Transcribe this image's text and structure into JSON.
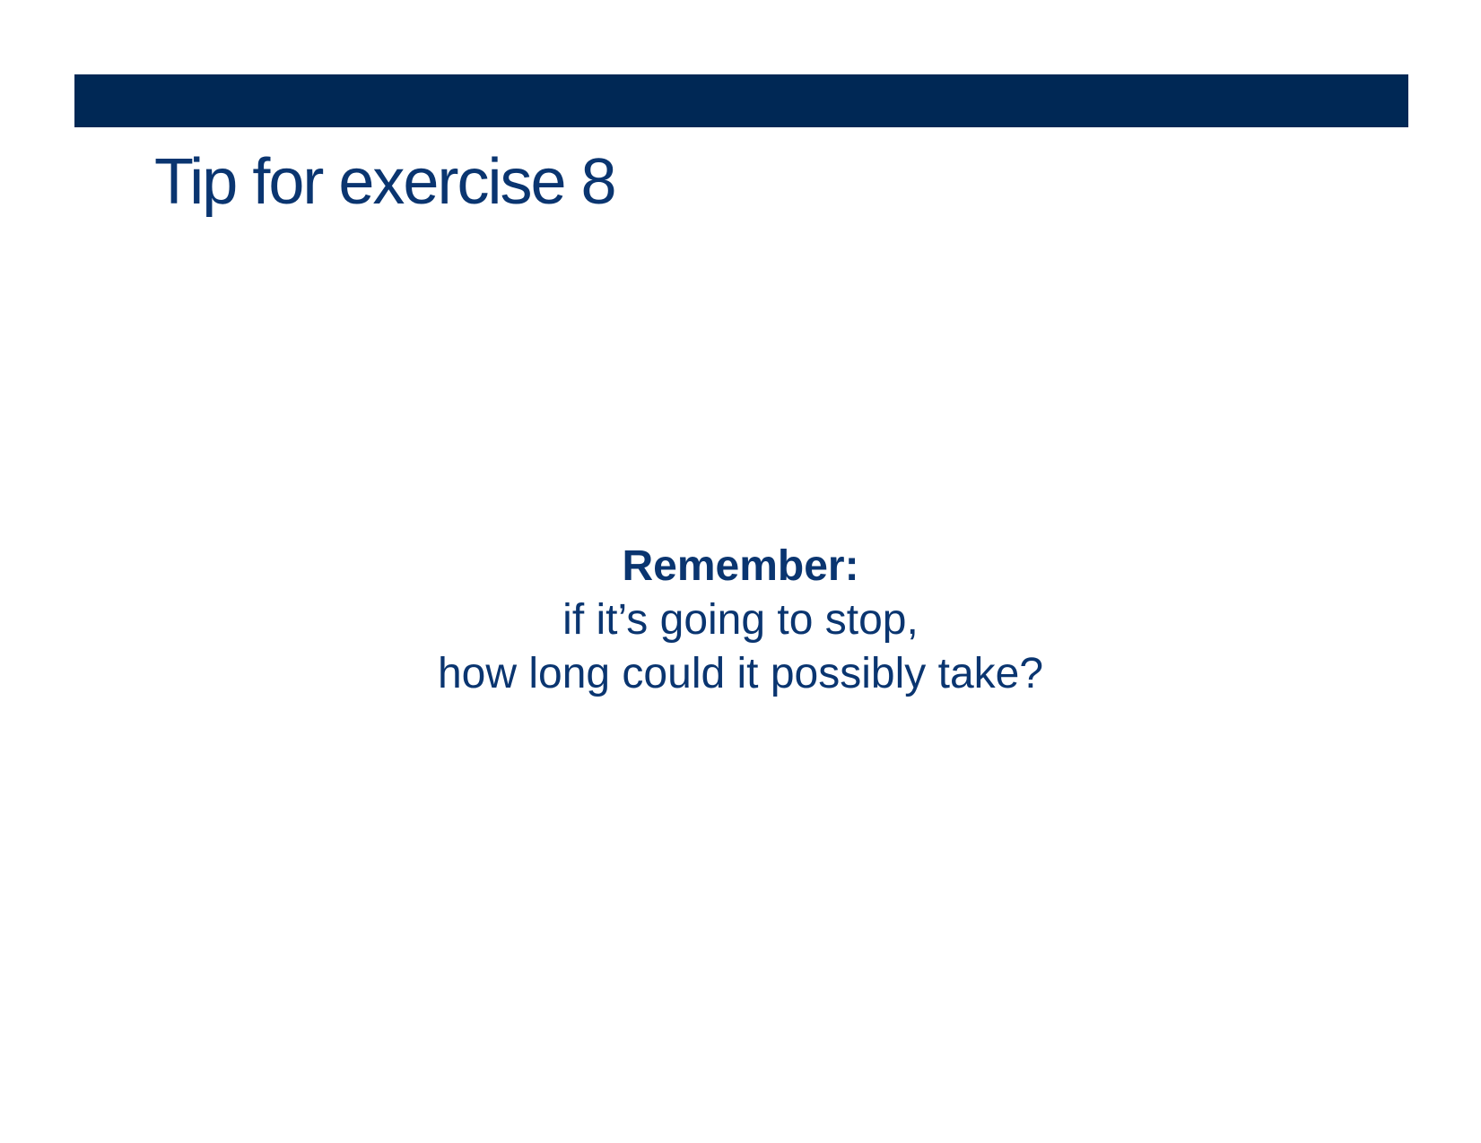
{
  "slide": {
    "title": "Tip for exercise 8",
    "body": {
      "label": "Remember:",
      "lines": [
        "if it’s going to stop,",
        "how long could it possibly take?"
      ]
    }
  },
  "colors": {
    "bar": "#002855",
    "text": "#0a3570",
    "background": "#ffffff"
  }
}
